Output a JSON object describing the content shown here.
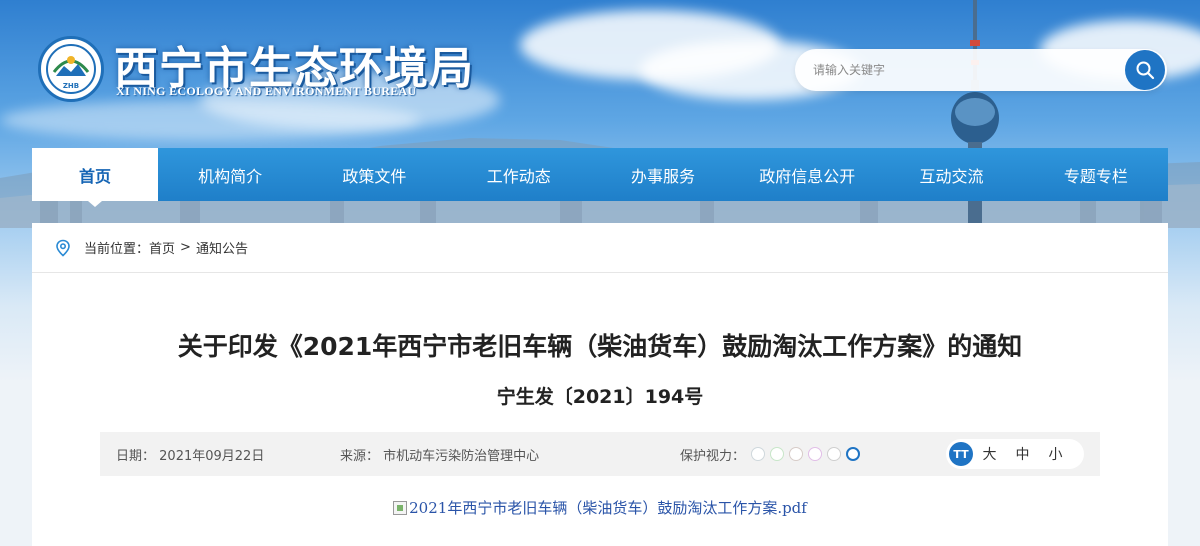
{
  "site": {
    "title": "西宁市生态环境局",
    "subtitle": "XI NING ECOLOGY AND ENVIRONMENT BUREAU",
    "logo_text": "ZHB"
  },
  "search": {
    "placeholder": "请输入关键字",
    "icon": "search-icon"
  },
  "nav": {
    "items": [
      {
        "label": "首页",
        "active": true
      },
      {
        "label": "机构简介"
      },
      {
        "label": "政策文件"
      },
      {
        "label": "工作动态"
      },
      {
        "label": "办事服务"
      },
      {
        "label": "政府信息公开"
      },
      {
        "label": "互动交流"
      },
      {
        "label": "专题专栏"
      }
    ]
  },
  "breadcrumb": {
    "prefix": "当前位置：",
    "home": "首页",
    "separator": ">",
    "current": "通知公告"
  },
  "article": {
    "title": "关于印发《2021年西宁市老旧车辆（柴油货车）鼓励淘汰工作方案》的通知",
    "doc_number": "宁生发〔2021〕194号",
    "date_label": "日期：",
    "date": "2021年09月22日",
    "source_label": "来源：",
    "source": "市机动车污染防治管理中心",
    "eye_label": "保护视力：",
    "eye_colors": [
      "#cfd8dc",
      "#c8e6c9",
      "#d7ccc8",
      "#e1bee7",
      "#cfcfcf",
      "#1f74c4"
    ],
    "font_size_icon": "TT",
    "font_sizes": [
      "大",
      "中",
      "小"
    ],
    "attachment": "2021年西宁市老旧车辆（柴油货车）鼓励淘汰工作方案.pdf"
  },
  "colors": {
    "nav_bg": "#1f7fc9",
    "accent": "#1f74c4",
    "link": "#2a54a8"
  }
}
